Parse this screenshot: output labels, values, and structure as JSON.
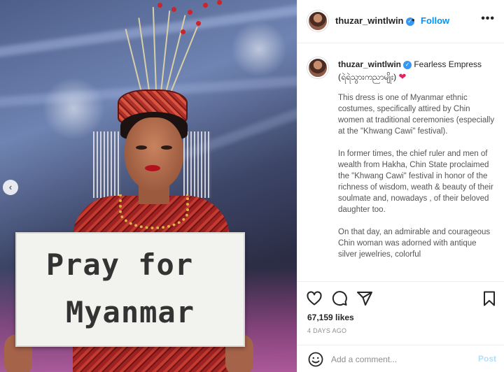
{
  "post": {
    "username": "thuzar_wintlwin",
    "follow_label": "Follow",
    "more_label": "•••",
    "carousel_prev": "‹",
    "sign_line1": "Pray for",
    "sign_line2": "Myanmar"
  },
  "caption": {
    "username": "thuzar_wintlwin",
    "title": "Fearless Empress",
    "subtitle": "(ရဲရဲသွားကညာမျိုး)",
    "heart": "❤",
    "paragraphs": [
      "This dress is one of Myanmar ethnic costumes, specifically attired by Chin women at traditional ceremonies (especially at the \"Khwang Cawi\" festival).",
      "In former times, the chief ruler and men of wealth from Hakha, Chin State proclaimed the \"Khwang Cawi\" festival in honor of the richness of wisdom, weath & beauty of their soulmate and, nowadays , of their beloved daughter too.",
      "On that day, an admirable and courageous Chin woman was adorned with antique silver jewelries, colorful"
    ]
  },
  "actions": {
    "likes": "67,159 likes",
    "time_ago": "4 DAYS AGO",
    "comment_placeholder": "Add a comment...",
    "post_label": "Post"
  },
  "colors": {
    "accent": "#0095f6",
    "post_disabled": "#b2dffc",
    "heart": "#e0245e",
    "verified": "#3897f0"
  },
  "icons": [
    "chevron-left-icon",
    "verified-icon",
    "more-icon",
    "heart-icon",
    "comment-icon",
    "share-icon",
    "bookmark-icon",
    "smile-icon"
  ]
}
